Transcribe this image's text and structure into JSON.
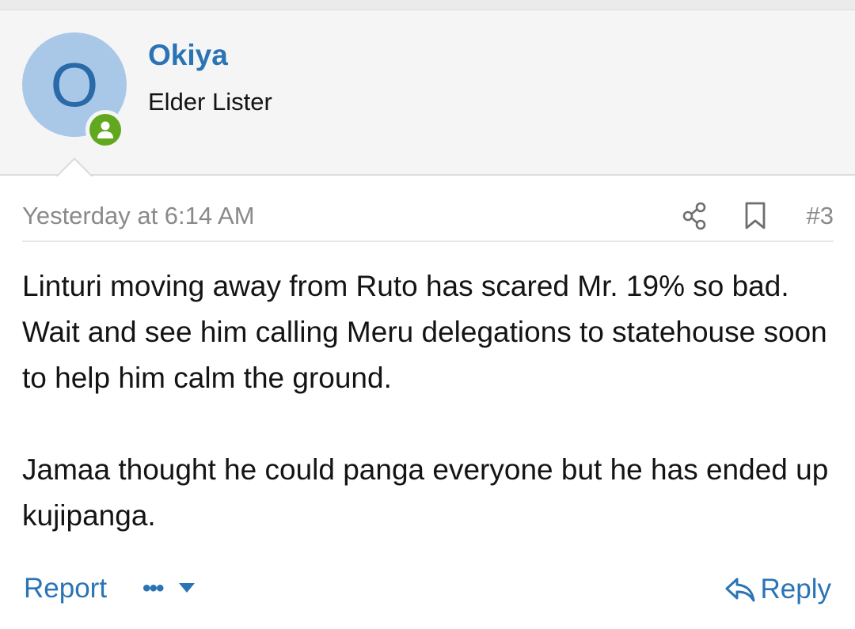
{
  "user": {
    "avatar_letter": "O",
    "avatar_bg": "#a9c8e7",
    "name": "Okiya",
    "title": "Elder Lister",
    "online_icon": "person-icon",
    "online_color": "#62a81e"
  },
  "post": {
    "date": "Yesterday at 6:14 AM",
    "number": "#3",
    "paragraphs": [
      "Linturi moving away from Ruto has scared Mr. 19% so bad. Wait and see him calling Meru delegations to statehouse soon to help him calm the ground.",
      "Jamaa thought he could panga everyone but he has ended up kujipanga."
    ],
    "icons": {
      "share": "share-icon",
      "bookmark": "bookmark-icon"
    }
  },
  "actions": {
    "report_label": "Report",
    "more_label": "•••",
    "reply_label": "Reply"
  },
  "colors": {
    "link": "#2a74b5",
    "header_bg": "#f5f5f5",
    "muted_text": "#8a8a8a"
  }
}
